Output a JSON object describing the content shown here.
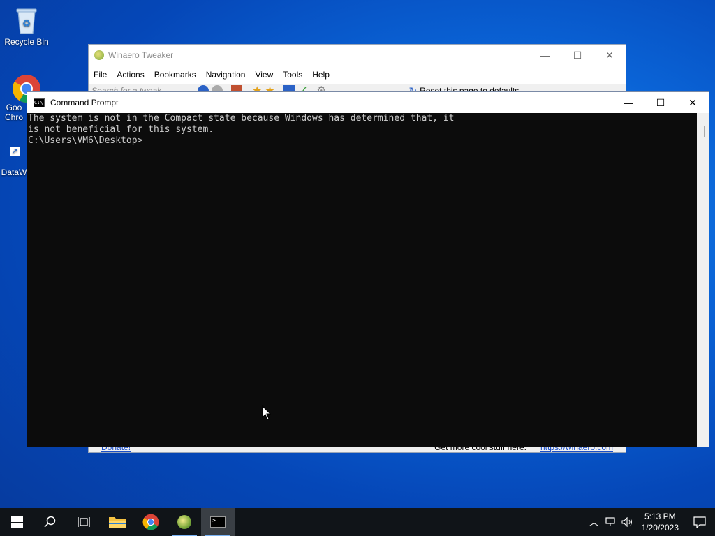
{
  "desktop": {
    "icons": [
      {
        "label": "Recycle Bin"
      },
      {
        "label": "Goo Chro"
      },
      {
        "label": "DataW"
      }
    ]
  },
  "winaero": {
    "title": "Winaero Tweaker",
    "menu": [
      "File",
      "Actions",
      "Bookmarks",
      "Navigation",
      "View",
      "Tools",
      "Help"
    ],
    "search_placeholder": "Search for a tweak",
    "reset_label": "Reset this page to defaults",
    "donate_label": "Donate!",
    "status_text": "Get more cool stuff here:",
    "status_link": "https://winaero.com"
  },
  "cmd": {
    "title": "Command Prompt",
    "lines": [
      "The system is not in the Compact state because Windows has determined that, it",
      "is not beneficial for this system.",
      "",
      "C:\\Users\\VM6\\Desktop>"
    ]
  },
  "taskbar": {
    "time": "5:13 PM",
    "date": "1/20/2023"
  },
  "colors": {
    "console_bg": "#0c0c0c",
    "console_text": "#cccccc",
    "taskbar_bg": "#101418",
    "accent": "#7ab3f5"
  }
}
